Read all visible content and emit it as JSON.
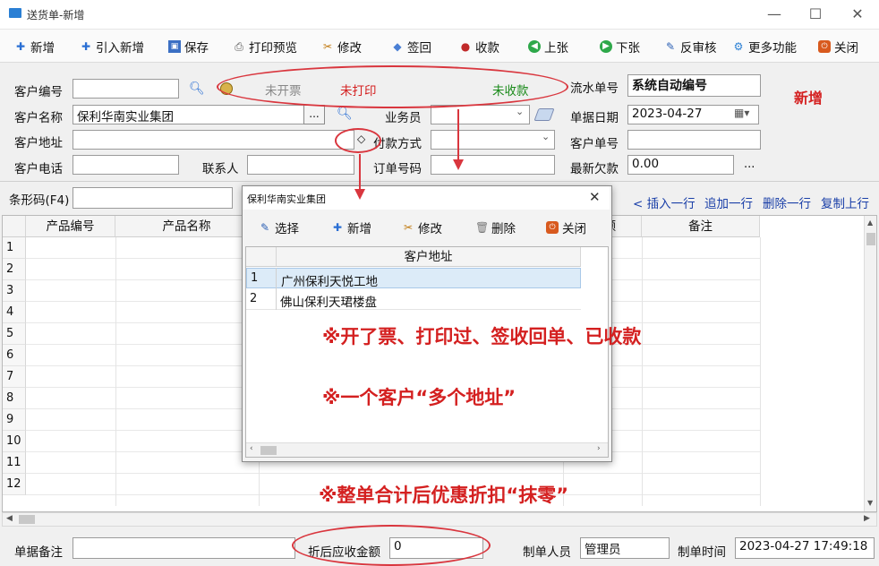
{
  "window": {
    "title": "送货单-新增",
    "minimize": "—",
    "maximize": "☐",
    "close": "✕"
  },
  "toolbar": {
    "new": "新增",
    "import_new": "引入新增",
    "save": "保存",
    "print_preview": "打印预览",
    "edit": "修改",
    "sign_back": "签回",
    "collect": "收款",
    "prev": "上张",
    "next": "下张",
    "unaudit": "反审核",
    "more": "更多功能",
    "close": "关闭"
  },
  "header": {
    "customer_code_label": "客户编号",
    "customer_code_value": "",
    "status_invoice": "未开票",
    "status_print": "未打印",
    "status_collect": "未收款",
    "serial_label": "流水单号",
    "serial_value": "系统自动编号",
    "mode_badge": "新增",
    "customer_name_label": "客户名称",
    "customer_name_value": "保利华南实业集团",
    "salesman_label": "业务员",
    "salesman_value": "",
    "doc_date_label": "单据日期",
    "doc_date_value": "2023-04-27",
    "customer_addr_label": "客户地址",
    "customer_addr_value": "",
    "payment_label": "付款方式",
    "payment_value": "",
    "customer_doc_label": "客户单号",
    "customer_doc_value": "",
    "customer_phone_label": "客户电话",
    "customer_phone_value": "",
    "contact_label": "联系人",
    "contact_value": "",
    "order_no_label": "订单号码",
    "order_no_value": "",
    "latest_debt_label": "最新欠款",
    "latest_debt_value": "0.00",
    "more_dots": "...",
    "browse_dots": "...",
    "diamond": "◇"
  },
  "barcode": {
    "label": "条形码(F4)",
    "value": ""
  },
  "row_actions": {
    "insert": "< 插入一行",
    "append": "追加一行",
    "delete": "删除一行",
    "copy": "复制上行"
  },
  "grid": {
    "columns": [
      "产品编号",
      "产品名称",
      "额",
      "备注"
    ],
    "row_numbers": [
      "1",
      "2",
      "3",
      "4",
      "5",
      "6",
      "7",
      "8",
      "9",
      "10",
      "11",
      "12"
    ]
  },
  "dialog": {
    "title": "保利华南实业集团",
    "close": "✕",
    "buttons": {
      "select": "选择",
      "new": "新增",
      "edit": "修改",
      "delete": "删除",
      "close": "关闭"
    },
    "column": "客户地址",
    "rows": [
      {
        "no": "1",
        "addr": "广州保利天悦工地"
      },
      {
        "no": "2",
        "addr": "佛山保利天珺楼盘"
      }
    ]
  },
  "annotations": {
    "note1": "※开了票、打印过、签收回单、已收款",
    "note2": "※一个客户“多个地址”",
    "note3": "※整单合计后优惠折扣“抹零”"
  },
  "footer": {
    "remark_label": "单据备注",
    "remark_value": "",
    "discount_label": "折后应收金额",
    "discount_value": "0",
    "maker_label": "制单人员",
    "maker_value": "管理员",
    "make_time_label": "制单时间",
    "make_time_value": "2023-04-27 17:49:18"
  },
  "colors": {
    "accent_red": "#d42020",
    "status_green": "#1a8a1a",
    "ellipse_red": "#d9363e",
    "link_blue": "#1a3fa8"
  }
}
